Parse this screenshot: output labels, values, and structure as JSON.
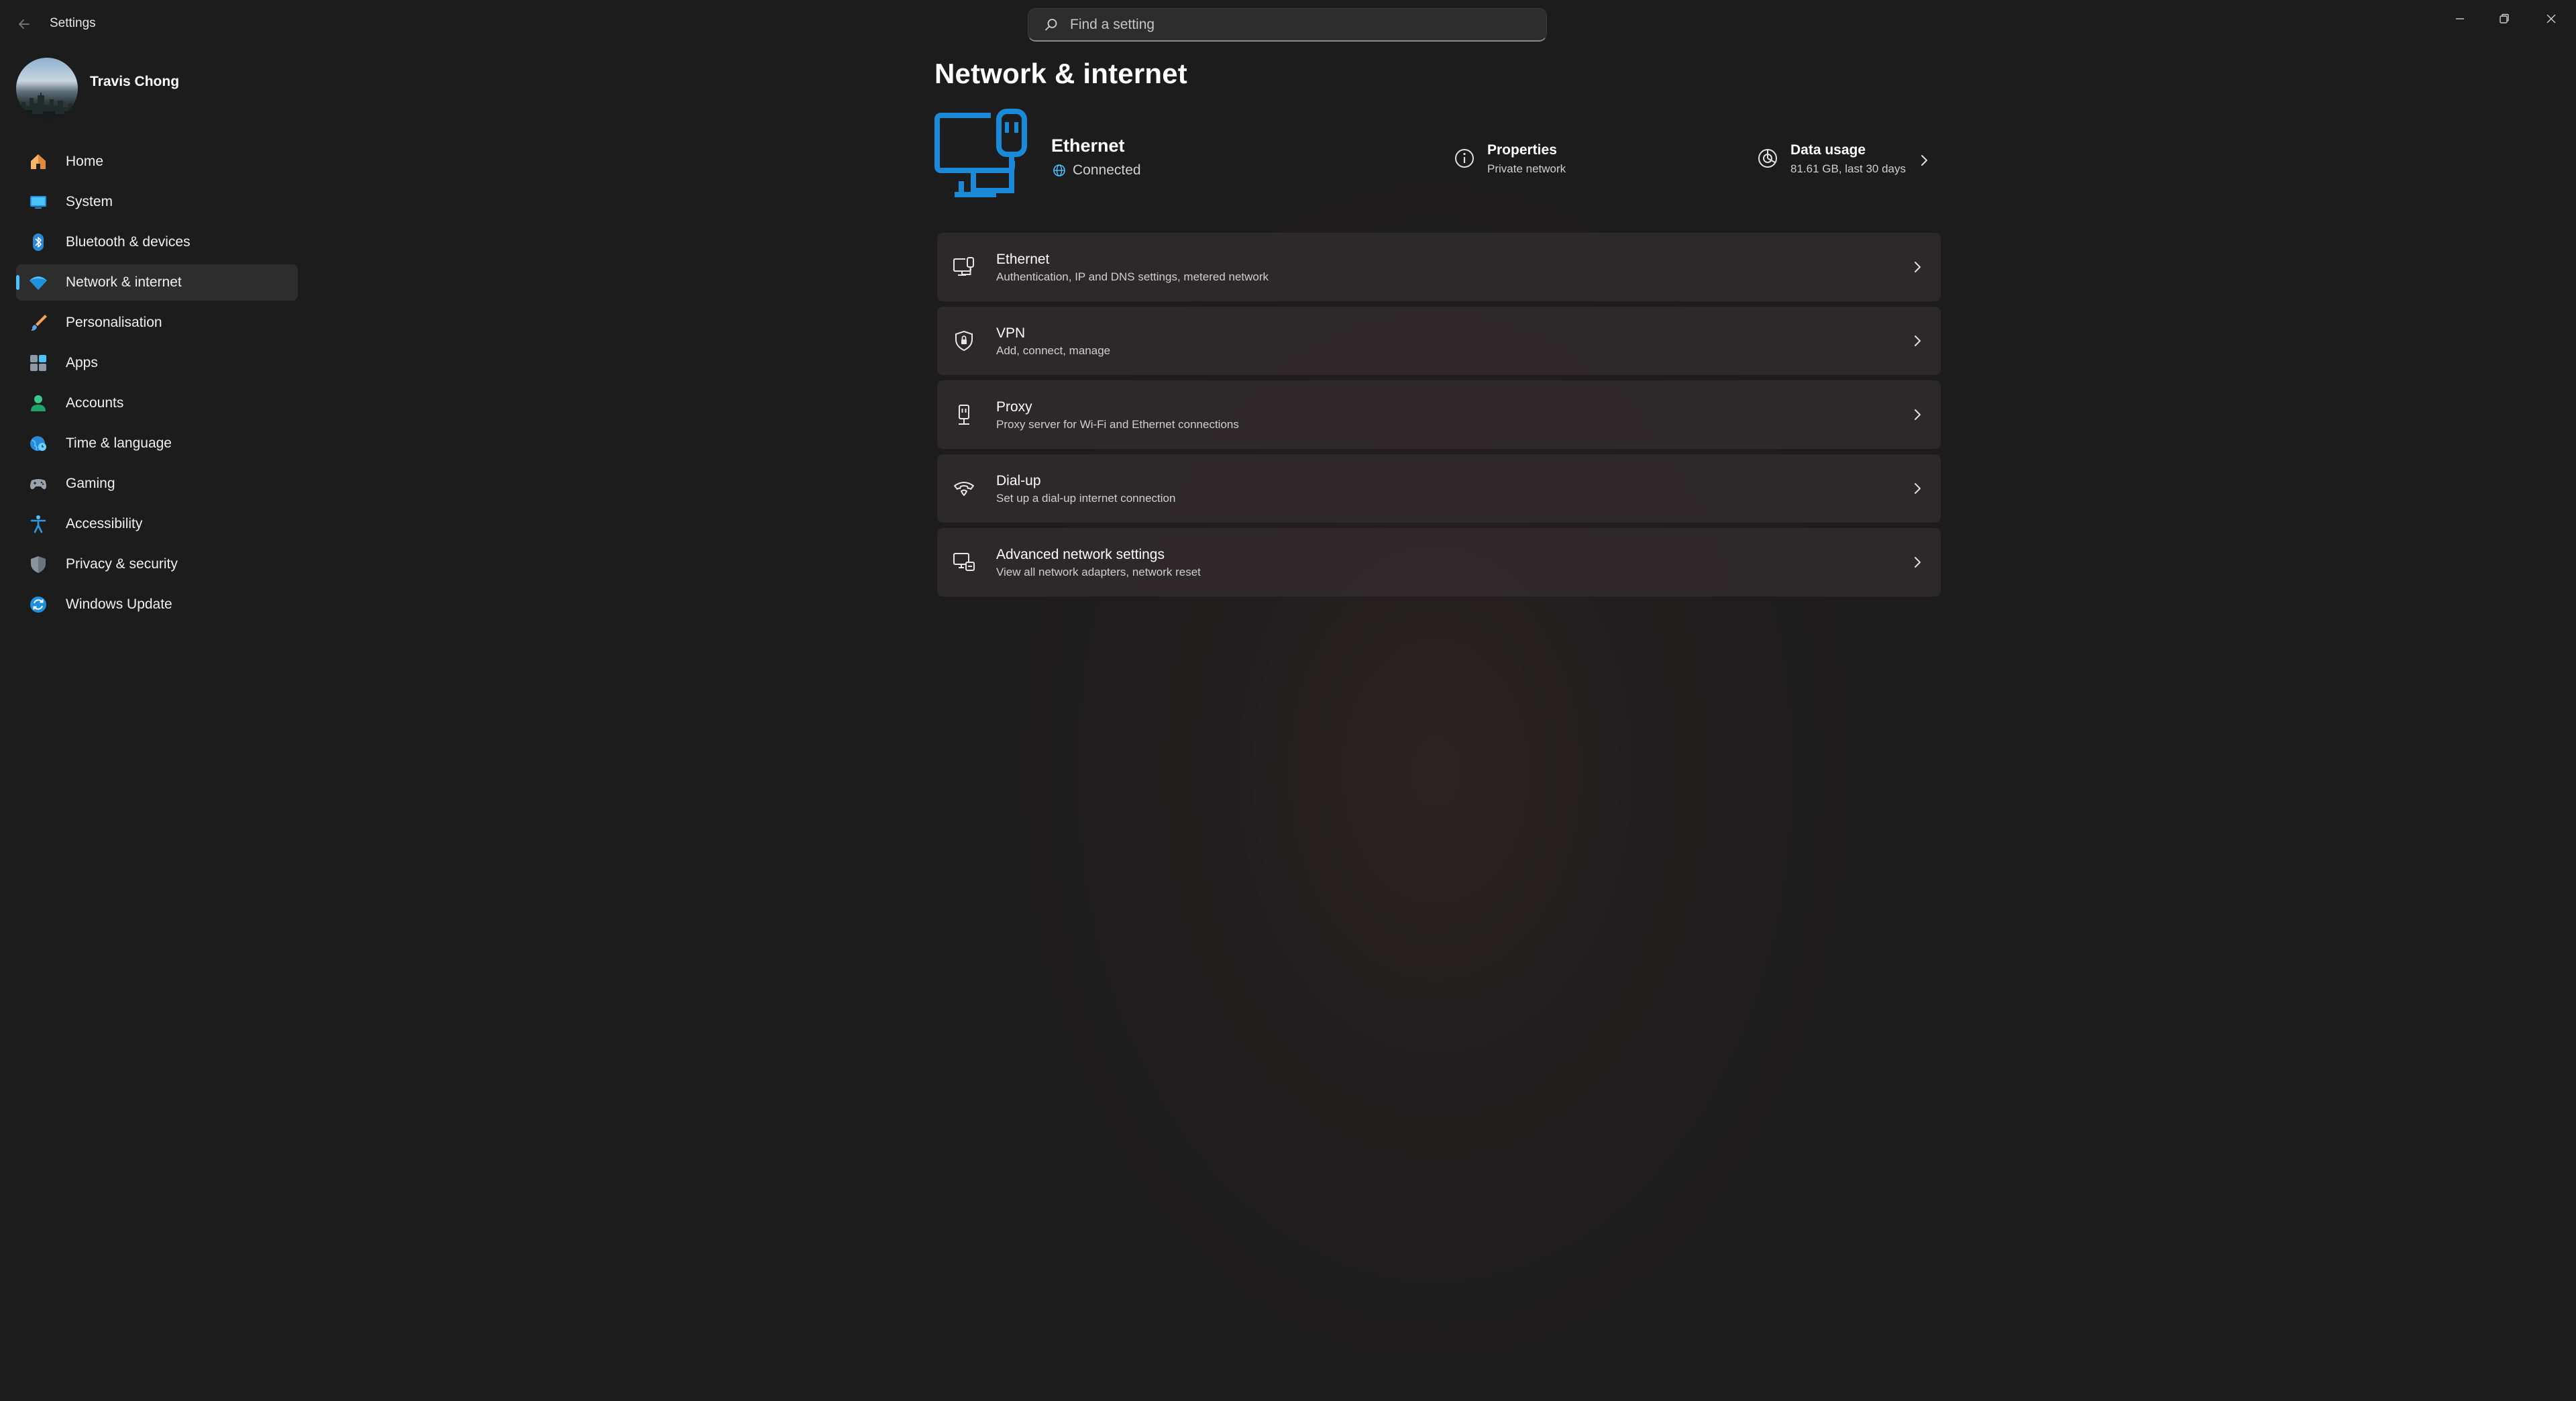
{
  "app": {
    "title": "Settings"
  },
  "search": {
    "placeholder": "Find a setting",
    "icon": "search-icon"
  },
  "window_controls": [
    "minimize-icon",
    "restore-icon",
    "close-icon"
  ],
  "profile": {
    "name": "Travis Chong"
  },
  "sidebar": {
    "accent": "#4cc2ff",
    "items": [
      {
        "label": "Home",
        "icon": "home-icon",
        "selected": false
      },
      {
        "label": "System",
        "icon": "system-icon",
        "selected": false
      },
      {
        "label": "Bluetooth & devices",
        "icon": "bluetooth-icon",
        "selected": false
      },
      {
        "label": "Network & internet",
        "icon": "network-icon",
        "selected": true
      },
      {
        "label": "Personalisation",
        "icon": "brush-icon",
        "selected": false
      },
      {
        "label": "Apps",
        "icon": "apps-icon",
        "selected": false
      },
      {
        "label": "Accounts",
        "icon": "accounts-icon",
        "selected": false
      },
      {
        "label": "Time & language",
        "icon": "globe-clock-icon",
        "selected": false
      },
      {
        "label": "Gaming",
        "icon": "gamepad-icon",
        "selected": false
      },
      {
        "label": "Accessibility",
        "icon": "accessibility-icon",
        "selected": false
      },
      {
        "label": "Privacy & security",
        "icon": "shield-icon",
        "selected": false
      },
      {
        "label": "Windows Update",
        "icon": "update-icon",
        "selected": false
      }
    ]
  },
  "main": {
    "title": "Network & internet",
    "hero": {
      "name": "Ethernet",
      "status": "Connected",
      "properties": {
        "title": "Properties",
        "subtitle": "Private network"
      },
      "data_usage": {
        "title": "Data usage",
        "subtitle": "81.61 GB, last 30 days"
      }
    },
    "cards": [
      {
        "title": "Ethernet",
        "subtitle": "Authentication, IP and DNS settings, metered network",
        "icon": "ethernet-icon"
      },
      {
        "title": "VPN",
        "subtitle": "Add, connect, manage",
        "icon": "vpn-shield-icon"
      },
      {
        "title": "Proxy",
        "subtitle": "Proxy server for Wi-Fi and Ethernet connections",
        "icon": "proxy-icon"
      },
      {
        "title": "Dial-up",
        "subtitle": "Set up a dial-up internet connection",
        "icon": "dialup-icon"
      },
      {
        "title": "Advanced network settings",
        "subtitle": "View all network adapters, network reset",
        "icon": "advanced-network-icon"
      }
    ]
  }
}
